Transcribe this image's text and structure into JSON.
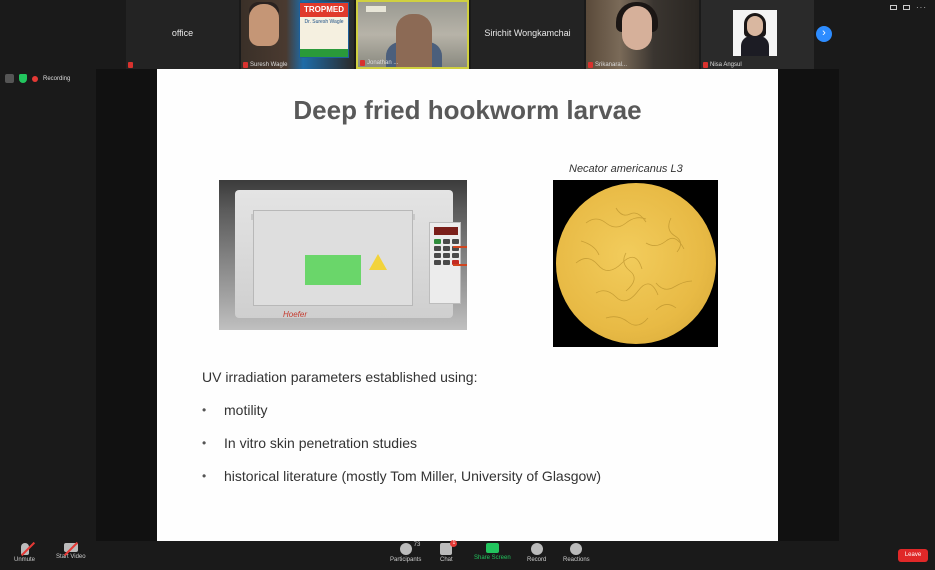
{
  "gallery": {
    "tiles": [
      {
        "name": "office"
      },
      {
        "name": "Suresh Wagle",
        "banner_title": "TROPMED",
        "banner_sub": "Dr. Suresh Wagle"
      },
      {
        "name": "Jonathan ..."
      },
      {
        "name": "Sirichit Wongkamchai"
      },
      {
        "name": "Srikanaral..."
      },
      {
        "name": "Nisa Angsul"
      }
    ],
    "next_label": "›"
  },
  "status": {
    "recording_label": "Recording"
  },
  "slide": {
    "title": "Deep fried hookworm larvae",
    "device_brand": "Hoefer",
    "micro_label": "Necator americanus L3",
    "intro": "UV irradiation parameters established using:",
    "bullets": [
      "motility",
      "In vitro skin penetration studies",
      "historical literature (mostly Tom Miller, University of Glasgow)"
    ],
    "bullet_char": "•"
  },
  "toolbar": {
    "unmute": "Unmute",
    "start_video": "Start Video",
    "participants": "Participants",
    "participant_count": "73",
    "chat": "Chat",
    "chat_badge": "1",
    "share": "Share Screen",
    "record": "Record",
    "reactions": "Reactions",
    "leave": "Leave"
  },
  "colors": {
    "accent": "#2d8cff",
    "share": "#22c55e",
    "leave": "#e02828",
    "recording": "#e53935"
  }
}
